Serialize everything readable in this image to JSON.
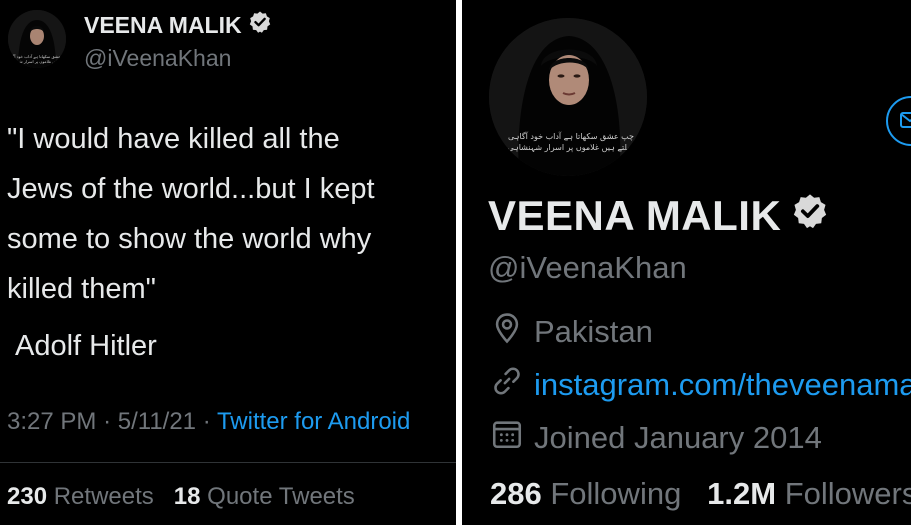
{
  "tweet": {
    "author_name": "VEENA MALIK",
    "handle": "@iVeenaKhan",
    "text_lines": [
      "\"I would have killed all the",
      "Jews of the world...but I kept",
      "some to show the world why",
      "killed them\""
    ],
    "attribution": "Adolf Hitler",
    "time": "3:27 PM",
    "date": "5/11/21",
    "source": "Twitter for Android",
    "retweets_count": "230",
    "retweets_label": "Retweets",
    "quotes_count": "18",
    "quotes_label": "Quote Tweets",
    "separator": "·"
  },
  "profile": {
    "name": "VEENA MALIK",
    "handle": "@iVeenaKhan",
    "location": "Pakistan",
    "website": "instagram.com/theveenamalik",
    "joined": "Joined January 2014",
    "following_count": "286",
    "following_label": "Following",
    "followers_count": "1.2M",
    "followers_label": "Followers",
    "avatar_caption_line1": "چپ عشق سکھاتا ہے آداب خود آگاہی",
    "avatar_caption_line2": "کھلتے ہیں غلاموں پر اسرار شہنشاہی"
  },
  "colors": {
    "background": "#000000",
    "text": "#e7e9ea",
    "muted": "#71767b",
    "accent": "#1d9bf0",
    "divider": "#ffffff"
  },
  "icons": [
    "verified-badge-icon",
    "location-pin-icon",
    "link-icon",
    "calendar-icon",
    "message-icon"
  ]
}
